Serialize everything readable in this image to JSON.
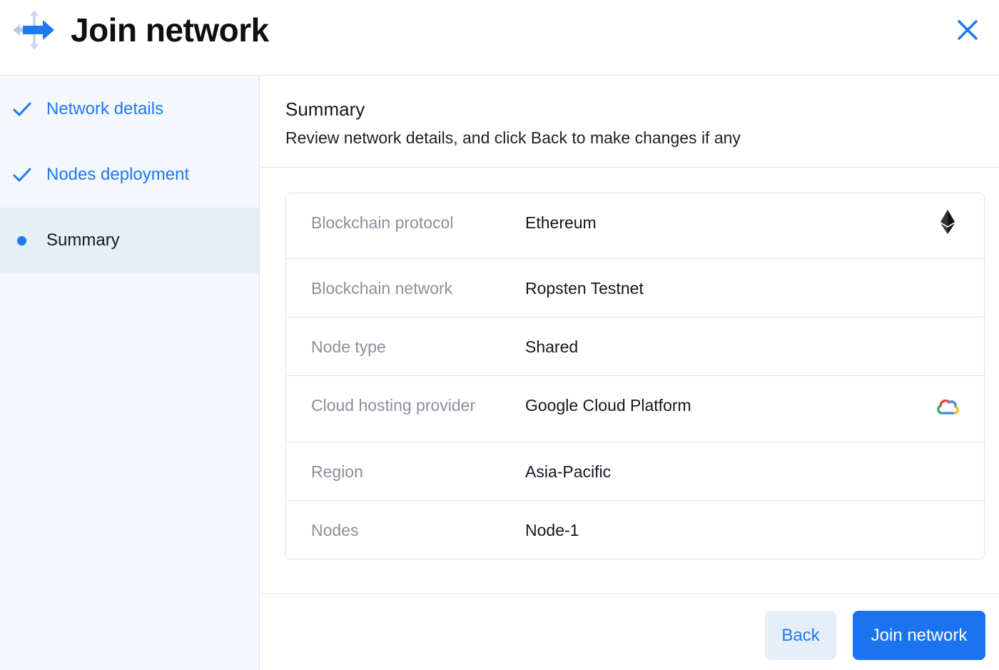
{
  "header": {
    "title": "Join network",
    "logo_icon": "arrows-move-icon",
    "close_icon": "close-icon"
  },
  "sidebar": {
    "steps": [
      {
        "label": "Network details",
        "state": "done",
        "icon": "checkmark-icon"
      },
      {
        "label": "Nodes deployment",
        "state": "done",
        "icon": "checkmark-icon"
      },
      {
        "label": "Summary",
        "state": "active",
        "icon": "dot-icon"
      }
    ]
  },
  "main": {
    "title": "Summary",
    "subtitle": "Review network details, and click Back to make changes if any",
    "rows": [
      {
        "key": "Blockchain protocol",
        "value": "Ethereum",
        "icon": "ethereum-icon"
      },
      {
        "key": "Blockchain network",
        "value": "Ropsten Testnet"
      },
      {
        "key": "Node type",
        "value": "Shared"
      },
      {
        "key": "Cloud hosting provider",
        "value": "Google Cloud Platform",
        "icon": "google-cloud-icon"
      },
      {
        "key": "Region",
        "value": "Asia-Pacific"
      },
      {
        "key": "Nodes",
        "value": "Node-1"
      }
    ]
  },
  "footer": {
    "back_label": "Back",
    "join_label": "Join network"
  },
  "colors": {
    "accent": "#1f79f0",
    "sidebar_bg": "#f4f7fb",
    "active_step_bg": "#e6eef8",
    "border": "#dfe3ea",
    "muted_text": "#8a909a"
  }
}
